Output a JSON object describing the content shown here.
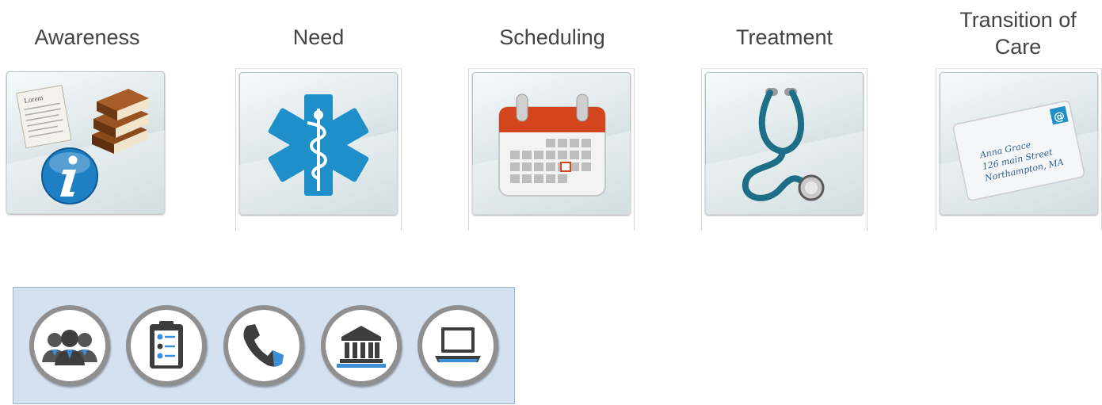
{
  "stages": [
    {
      "label": "Awareness",
      "icon": "info-books-icon"
    },
    {
      "label": "Need",
      "icon": "star-of-life-icon"
    },
    {
      "label": "Scheduling",
      "icon": "calendar-icon"
    },
    {
      "label": "Treatment",
      "icon": "stethoscope-icon"
    },
    {
      "label": "Transition of\nCare",
      "icon": "envelope-icon"
    }
  ],
  "awareness_doc_title": "Lorem",
  "envelope": {
    "line1": "Anna Grace",
    "line2": "126 main Street",
    "line3": "Northampton, MA",
    "at_symbol": "@"
  },
  "channels": [
    {
      "icon": "group-icon"
    },
    {
      "icon": "clipboard-checklist-icon"
    },
    {
      "icon": "phone-icon"
    },
    {
      "icon": "institution-icon"
    },
    {
      "icon": "laptop-icon"
    }
  ],
  "colors": {
    "accent_blue": "#1e8fc9",
    "calendar_red": "#d3451c",
    "channel_panel": "#d4e1f0",
    "label_text": "#444444"
  }
}
